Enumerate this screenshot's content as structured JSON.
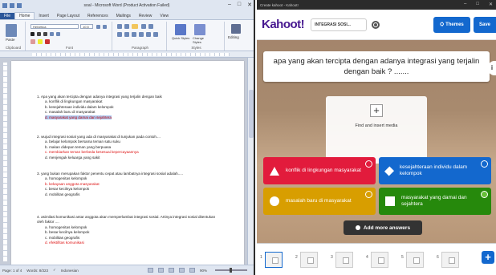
{
  "word": {
    "title": "soal - Microsoft Word (Product Activation Failed)",
    "tabs": [
      "File",
      "Home",
      "Insert",
      "Page Layout",
      "References",
      "Mailings",
      "Review",
      "View"
    ],
    "ribbon": {
      "font_name": "Helvetica",
      "font_size": "10,5",
      "groups": [
        "Clipboard",
        "Font",
        "Paragraph",
        "Styles"
      ],
      "quick_styles": "Quick Styles",
      "change_styles": "Change Styles",
      "editing": "Editing",
      "paste": "Paste"
    },
    "questions": [
      {
        "text": "1.  Apa yang akan tercipta dengan adanya integrasi yang terjalin dengan baik",
        "options": [
          {
            "text": "a.  konflik di lingkungan masyarakat",
            "style": "normal"
          },
          {
            "text": "b.  kesejahteraan individu dalam kelompok",
            "style": "normal"
          },
          {
            "text": "c.  masalah baru di masyarakat",
            "style": "normal"
          },
          {
            "text": "d.  masyarakat yang damai dan sejahtera",
            "style": "selected"
          }
        ]
      },
      {
        "text": "2.  wujud integrasi sosial yang ada di masyarakat di tunjukan pada contoh....",
        "options": [
          {
            "text": "a.  belajar kelompok bersama teman satu suku",
            "style": "normal"
          },
          {
            "text": "b.  makan didepan teman yang berpuasa",
            "style": "normal"
          },
          {
            "text": "c.  membiarkan teman berbeda kesesuai kepercayaannya",
            "style": "red"
          },
          {
            "text": "d.  menjenguk keluarga yang sakit",
            "style": "normal"
          }
        ]
      },
      {
        "text": "3.  yang bukan merupakan faktor penentu cepat atau lambatnya integrasi sosial adalah.....",
        "options": [
          {
            "text": "a.  homogenitas kelompok",
            "style": "normal"
          },
          {
            "text": "b.  kekayaan anggota masyarakat",
            "style": "red"
          },
          {
            "text": "c.  besar kecilnya kelompok",
            "style": "normal"
          },
          {
            "text": "d.  mobilitas geografis",
            "style": "normal"
          }
        ]
      },
      {
        "text": "4.  asimilasi komunikasi antar anggota akan memperlambat integrasi sosial. Artinya integrasi sosial ditentukan oleh faktor ....",
        "options": [
          {
            "text": "a.  homogenitas kelompok",
            "style": "normal"
          },
          {
            "text": "b.  besar kecilnya kelompok",
            "style": "normal"
          },
          {
            "text": "c.  mobilitas geografis",
            "style": "normal"
          },
          {
            "text": "d.  efektifitas komunikasi",
            "style": "red"
          }
        ]
      }
    ],
    "status": {
      "page": "Page: 1 of 4",
      "words": "Words: 8/323",
      "language": "Indonesian",
      "zoom": "90%"
    }
  },
  "kahoot": {
    "tab_title": "Create kahoot - Kahoot!",
    "logo": "Kahoot!",
    "title_field": "INTEGRASI SOSI...",
    "themes_label": "Themes",
    "save_label": "Save",
    "question": "apa yang akan tercipta dengan adanya integrasi yang terjalin dengan baik ? .......",
    "media_label": "Find and insert media",
    "answers": [
      {
        "text": "konflik di lingkungan masyarakat",
        "color": "#e21b3c",
        "shape": "triangle",
        "correct": false
      },
      {
        "text": "kesejahteraan individu dalam kelompok",
        "color": "#1368ce",
        "shape": "diamond",
        "correct": false
      },
      {
        "text": "masalah baru di masyarakat",
        "color": "#d89e00",
        "shape": "circle",
        "correct": false
      },
      {
        "text": "masyarakat yang damai dan sejahtera",
        "color": "#26890c",
        "shape": "square",
        "correct": true
      }
    ],
    "add_more_label": "Add more answers",
    "slides": [
      "1",
      "2",
      "3",
      "4",
      "5",
      "6"
    ]
  }
}
